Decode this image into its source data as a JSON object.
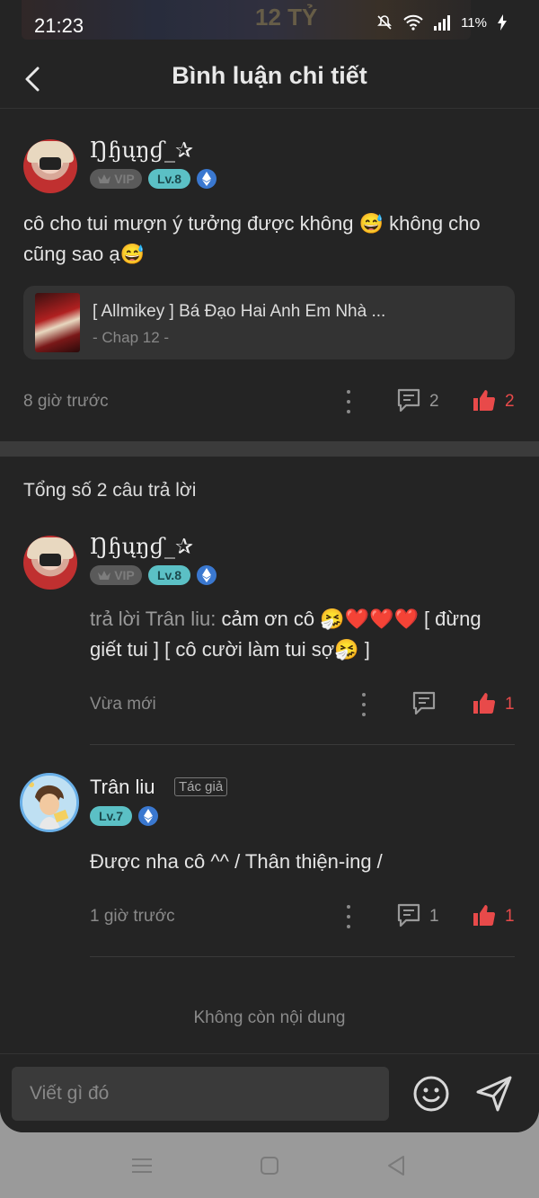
{
  "status_bar": {
    "time": "21:23",
    "battery": "11%",
    "ad_text": "12 TỶ"
  },
  "header": {
    "title": "Bình luận chi tiết"
  },
  "comment": {
    "username": "Ŋɧųŋɠ_✰",
    "vip_label": "VIP",
    "level": "Lv.8",
    "text": "cô cho tui mượn ý tưởng được không 😅 không cho cũng sao ạ😅",
    "chapter_card": {
      "title": "[ Allmikey ] Bá Đạo Hai Anh Em Nhà ...",
      "subtitle": "- Chap 12 -"
    },
    "time": "8 giờ trước",
    "reply_count": "2",
    "like_count": "2"
  },
  "replies_header": "Tổng số 2 câu trả lời",
  "replies": [
    {
      "username": "Ŋɧųŋɠ_✰",
      "vip_label": "VIP",
      "level": "Lv.8",
      "reply_prefix": "trả lời Trân liu:",
      "text": " cảm ơn cô 🤧❤️❤️❤️ [ đừng giết tui ]  [ cô cười làm tui sợ🤧 ]",
      "time": "Vừa mới",
      "like_count": "1"
    },
    {
      "username": "Trân liu",
      "author_tag": "Tác giả",
      "level": "Lv.7",
      "text": "Được nha cô ^^ / Thân thiện-ing /",
      "time": "1 giờ trước",
      "reply_count": "1",
      "like_count": "1"
    }
  ],
  "end_text": "Không còn nội dung",
  "input": {
    "placeholder": "Viết gì đó"
  },
  "colors": {
    "background": "#242424",
    "accent_like": "#e84a4a",
    "level_badge": "#5bc0c5"
  }
}
